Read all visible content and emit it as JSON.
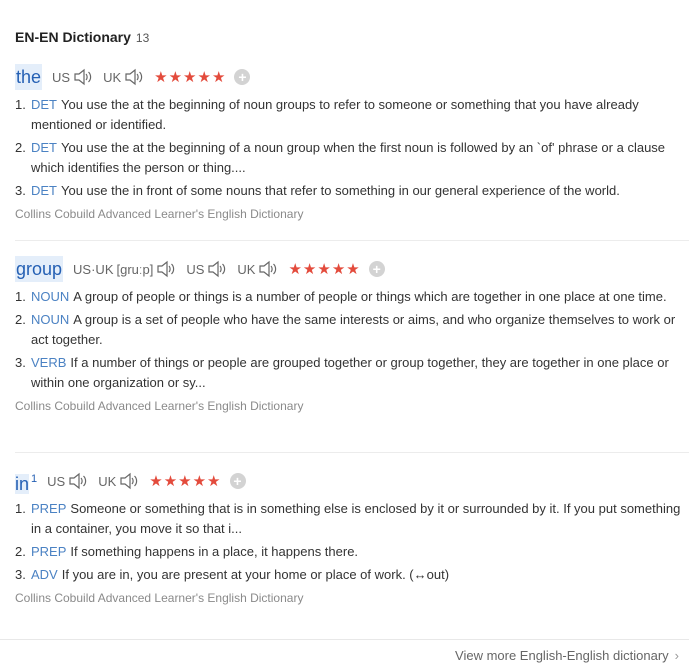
{
  "header": {
    "title": "EN-EN Dictionary",
    "count": "13"
  },
  "entries": [
    {
      "word": "the",
      "superscript": "",
      "pron": {
        "us_label": "US",
        "uk_label": "UK",
        "combined_label": "",
        "ipa": ""
      },
      "stars": "★★★★★",
      "plus": "+",
      "defs": [
        {
          "num": "1.",
          "pos": "DET",
          "text": "You use the at the beginning of noun groups to refer to someone or something that you have already mentioned or identified."
        },
        {
          "num": "2.",
          "pos": "DET",
          "text": "You use the at the beginning of a noun group when the first noun is followed by an `of' phrase or a clause which identifies the person or thing...."
        },
        {
          "num": "3.",
          "pos": "DET",
          "text": "You use the in front of some nouns that refer to something in our general experience of the world."
        }
      ],
      "source": "Collins Cobuild Advanced Learner's English Dictionary"
    },
    {
      "word": "group",
      "superscript": "",
      "pron": {
        "us_label": "US",
        "uk_label": "UK",
        "combined_label": "US·UK",
        "ipa": "[gruːp]"
      },
      "stars": "★★★★★",
      "plus": "+",
      "defs": [
        {
          "num": "1.",
          "pos": "NOUN",
          "text": "A group of people or things is a number of people or things which are together in one place at one time."
        },
        {
          "num": "2.",
          "pos": "NOUN",
          "text": "A group is a set of people who have the same interests or aims, and who organize themselves to work or act together."
        },
        {
          "num": "3.",
          "pos": "VERB",
          "text": "If a number of things or people are grouped together or group together, they are together in one place or within one organization or sy..."
        }
      ],
      "source": "Collins Cobuild Advanced Learner's English Dictionary"
    },
    {
      "word": "in",
      "superscript": "1",
      "pron": {
        "us_label": "US",
        "uk_label": "UK",
        "combined_label": "",
        "ipa": ""
      },
      "stars": "★★★★★",
      "plus": "+",
      "defs": [
        {
          "num": "1.",
          "pos": "PREP",
          "text": "Someone or something that is in something else is enclosed by it or surrounded by it. If you put something in a container, you move it so that i..."
        },
        {
          "num": "2.",
          "pos": "PREP",
          "text": "If something happens in a place, it happens there."
        },
        {
          "num": "3.",
          "pos": "ADV",
          "text": "If you are in, you are present at your home or place of work. (↔out)"
        }
      ],
      "source": "Collins Cobuild Advanced Learner's English Dictionary"
    }
  ],
  "footer": {
    "link": "View more English-English dictionary",
    "chevron": "›"
  },
  "colors": {
    "accent": "#2560b4",
    "pos": "#4b82c3",
    "stars": "#e34b3c",
    "highlight": "#e4eefa"
  },
  "icons": {
    "speaker": "speaker-icon",
    "plus": "plus-icon",
    "chevron": "chevron-right-icon"
  }
}
